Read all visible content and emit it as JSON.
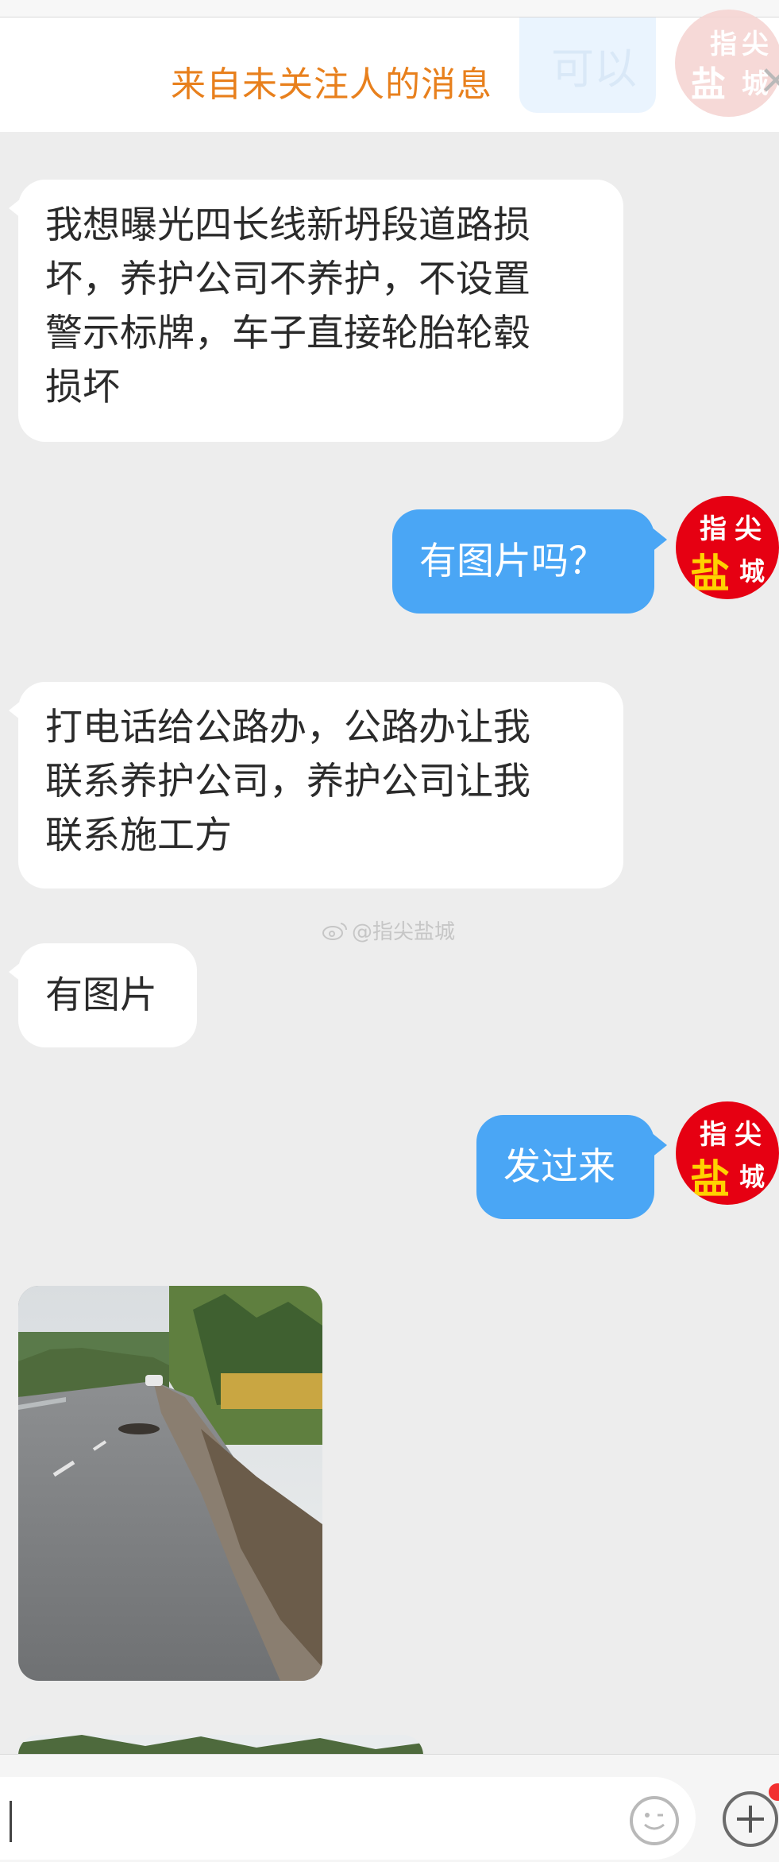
{
  "notice": {
    "text": "来自未关注人的消息",
    "quick_reply_label": "可以",
    "close_symbol": "×"
  },
  "avatar": {
    "line1_a": "指",
    "line1_b": "尖",
    "line2_a": "盐",
    "line2_b": "城",
    "bg_color": "#e60012"
  },
  "messages": [
    {
      "side": "in",
      "lines": [
        "我想曝光四长线新坍段道路损",
        "坏，养护公司不养护，不设置",
        "警示标牌，车子直接轮胎轮毂",
        "损坏"
      ]
    },
    {
      "side": "out",
      "lines": [
        "有图片吗？"
      ]
    },
    {
      "side": "in",
      "lines": [
        "打电话给公路办，公路办让我",
        "联系养护公司，养护公司让我",
        "联系施工方"
      ]
    },
    {
      "side": "in",
      "lines": [
        "有图片"
      ]
    },
    {
      "side": "out",
      "lines": [
        "发过来"
      ]
    }
  ],
  "watermark": "@指尖盐城",
  "colors": {
    "outgoing_bubble": "#4aa6f5",
    "notice_text": "#e8801d",
    "background": "#ededed"
  },
  "input": {
    "icons": [
      "emoji-icon",
      "plus-icon"
    ]
  }
}
